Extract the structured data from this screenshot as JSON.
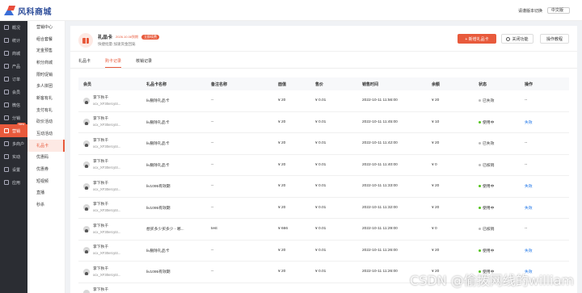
{
  "app": {
    "logo_text": "风科商城"
  },
  "topbar": {
    "lang_label": "请谨版本切换",
    "lang_value": "中文版"
  },
  "side_main": [
    {
      "label": "概况",
      "icon": "dashboard-icon"
    },
    {
      "label": "统计",
      "icon": "chart-icon"
    },
    {
      "label": "商城",
      "icon": "store-icon"
    },
    {
      "label": "产品",
      "icon": "product-icon"
    },
    {
      "label": "订单",
      "icon": "order-icon"
    },
    {
      "label": "会员",
      "icon": "member-icon"
    },
    {
      "label": "微信",
      "icon": "wechat-icon"
    },
    {
      "label": "分销",
      "icon": "distribution-icon"
    },
    {
      "label": "营销",
      "icon": "marketing-icon",
      "active": true,
      "badge": "New"
    },
    {
      "label": "多商户",
      "icon": "merchant-icon"
    },
    {
      "label": "实动",
      "icon": "activity-icon"
    },
    {
      "label": "设置",
      "icon": "settings-icon"
    },
    {
      "label": "应用",
      "icon": "apps-icon"
    }
  ],
  "side_sub": [
    "营销中心",
    "组合套餐",
    "定金预售",
    "积分商城",
    "限时促销",
    "多人拼团",
    "新客有礼",
    "支付有礼",
    "砍价活动",
    "互动活动",
    "礼品卡",
    "优惠码",
    "优惠券",
    "短视频",
    "直播",
    "秒杀"
  ],
  "header": {
    "title": "礼品卡",
    "date": "2026.10.08到期",
    "tag": "立即续费",
    "subtitle": "快捷批量·加速资金回笼",
    "add_button": "+ 新增礼品卡",
    "close_button": "关闭功能",
    "help_button": "操作教程"
  },
  "tabs": [
    {
      "label": "礼品卡",
      "active": false
    },
    {
      "label": "购卡记录",
      "active": true
    },
    {
      "label": "核销记录",
      "active": false
    }
  ],
  "table": {
    "columns": [
      "会员",
      "礼品卡名称",
      "备注名称",
      "面值",
      "售价",
      "销售时间",
      "余额",
      "状态",
      "操作"
    ],
    "rows": [
      {
        "name": "李下秋千",
        "sub": "xcx_XF30ercyt4...",
        "card": "liv删除礼品卡",
        "note": "--",
        "face": "¥ 20",
        "price": "¥ 0.01",
        "time": "2022-10-11 11:56:00",
        "balance": "¥ 20",
        "status": "已失效",
        "status_color": "grey",
        "op": "--"
      },
      {
        "name": "李下秋千",
        "sub": "xcx_XF30ercyt4...",
        "card": "liv删除礼品卡",
        "note": "--",
        "face": "¥ 20",
        "price": "¥ 0.01",
        "time": "2022-10-11 11:45:00",
        "balance": "¥ 10",
        "status": "使用中",
        "status_color": "green",
        "op": "失效"
      },
      {
        "name": "李下秋千",
        "sub": "xcx_XF30ercyt4...",
        "card": "liv删除礼品卡",
        "note": "--",
        "face": "¥ 20",
        "price": "¥ 0.01",
        "time": "2022-10-11 11:42:00",
        "balance": "¥ 20",
        "status": "已失效",
        "status_color": "grey",
        "op": "--"
      },
      {
        "name": "李下秋千",
        "sub": "xcx_XF30ercyt4...",
        "card": "liv删除礼品卡",
        "note": "--",
        "face": "¥ 20",
        "price": "¥ 0.01",
        "time": "2022-10-11 11:40:00",
        "balance": "¥ 0",
        "status": "已核销",
        "status_color": "grey",
        "op": "--"
      },
      {
        "name": "李下秋千",
        "sub": "xcx_XF30ercyt4...",
        "card": "liv1095有效期",
        "note": "--",
        "face": "¥ 20",
        "price": "¥ 0.01",
        "time": "2022-10-11 11:33:00",
        "balance": "¥ 20",
        "status": "使用中",
        "status_color": "green",
        "op": "失效"
      },
      {
        "name": "李下秋千",
        "sub": "xcx_XF30ercyt4...",
        "card": "liv1095有效期",
        "note": "--",
        "face": "¥ 20",
        "price": "¥ 0.01",
        "time": "2022-10-11 11:32:00",
        "balance": "¥ 20",
        "status": "使用中",
        "status_color": "green",
        "op": "失效"
      },
      {
        "name": "李下秋千",
        "sub": "xcx_XF30ercyt4...",
        "card": "想买多少买多少 - 哪...",
        "note": "test",
        "face": "¥ 666",
        "price": "¥ 0.01",
        "time": "2022-10-11 11:29:00",
        "balance": "¥ 0",
        "status": "已核销",
        "status_color": "grey",
        "op": "--"
      },
      {
        "name": "李下秋千",
        "sub": "xcx_XF30ercyt4...",
        "card": "liv删除礼品卡",
        "note": "--",
        "face": "¥ 20",
        "price": "¥ 0.01",
        "time": "2022-10-11 11:26:00",
        "balance": "¥ 20",
        "status": "使用中",
        "status_color": "green",
        "op": "失效"
      },
      {
        "name": "李下秋千",
        "sub": "xcx_XF30ercyt4...",
        "card": "liv1095有效期",
        "note": "--",
        "face": "¥ 20",
        "price": "¥ 0.01",
        "time": "2022-10-11 11:26:00",
        "balance": "¥ 20",
        "status": "使用中",
        "status_color": "green",
        "op": "失效"
      },
      {
        "name": "李下秋千",
        "sub": "xcx_XF30ercyt4...",
        "card": "",
        "note": "",
        "face": "",
        "price": "",
        "time": "",
        "balance": "",
        "status": "",
        "status_color": "grey",
        "op": ""
      }
    ]
  },
  "watermark": "CSDN @偷拨网线的william",
  "colors": {
    "accent": "#e85a3c",
    "sidebar_dark": "#2b2d33",
    "link": "#1a73e8",
    "success": "#52c41a"
  }
}
